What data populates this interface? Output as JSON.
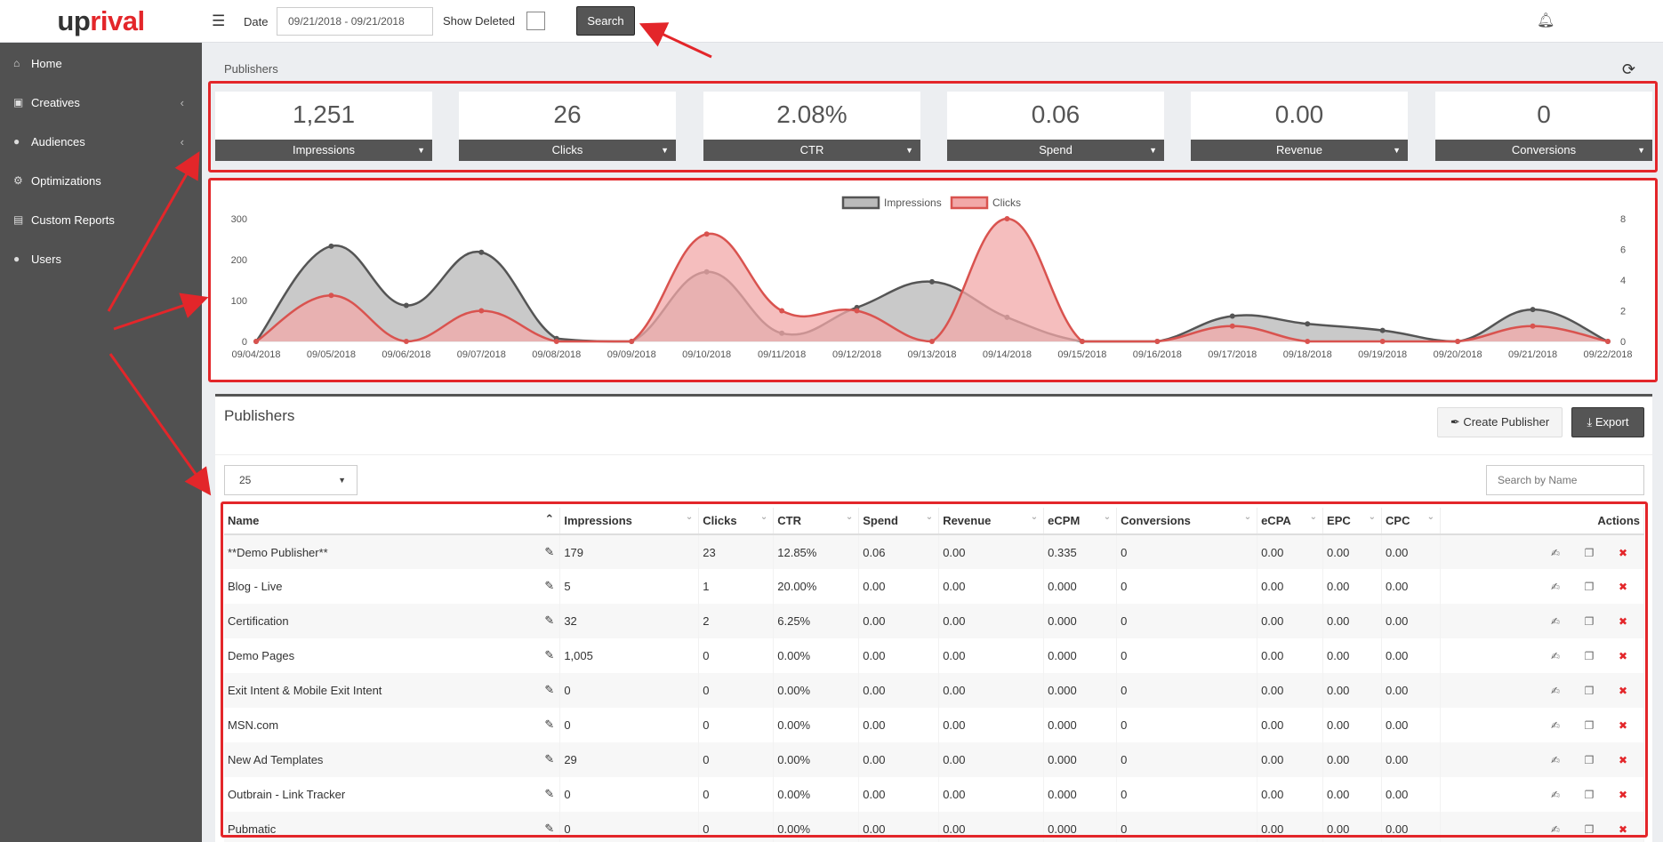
{
  "app": {
    "logo_prefix": "up",
    "logo_suffix": "rival"
  },
  "topbar": {
    "date_label": "Date",
    "date_value": "09/21/2018 - 09/21/2018",
    "show_deleted_label": "Show Deleted",
    "show_deleted_checked": false,
    "search_label": "Search"
  },
  "sidebar": {
    "items": [
      {
        "label": "Home",
        "icon": "home-icon"
      },
      {
        "label": "Creatives",
        "icon": "image-icon",
        "has_submenu": true
      },
      {
        "label": "Audiences",
        "icon": "users-icon",
        "has_submenu": true
      },
      {
        "label": "Optimizations",
        "icon": "cogs-icon"
      },
      {
        "label": "Custom Reports",
        "icon": "file-icon"
      },
      {
        "label": "Users",
        "icon": "user-icon"
      }
    ]
  },
  "content": {
    "section_title": "Publishers"
  },
  "stats": [
    {
      "value": "1,251",
      "label": "Impressions"
    },
    {
      "value": "26",
      "label": "Clicks"
    },
    {
      "value": "2.08%",
      "label": "CTR"
    },
    {
      "value": "0.06",
      "label": "Spend"
    },
    {
      "value": "0.00",
      "label": "Revenue"
    },
    {
      "value": "0",
      "label": "Conversions"
    }
  ],
  "chart_data": {
    "type": "area",
    "x": [
      "09/04/2018",
      "09/05/2018",
      "09/06/2018",
      "09/07/2018",
      "09/08/2018",
      "09/09/2018",
      "09/10/2018",
      "09/11/2018",
      "09/12/2018",
      "09/13/2018",
      "09/14/2018",
      "09/15/2018",
      "09/16/2018",
      "09/17/2018",
      "09/18/2018",
      "09/19/2018",
      "09/20/2018",
      "09/21/2018",
      "09/22/2018"
    ],
    "series": [
      {
        "name": "Impressions",
        "axis": "left",
        "color": "#555555",
        "fill": "#bbbbbb",
        "values": [
          0,
          233,
          88,
          218,
          7,
          0,
          170,
          20,
          83,
          146,
          59,
          0,
          0,
          62,
          43,
          27,
          0,
          78,
          0
        ]
      },
      {
        "name": "Clicks",
        "axis": "right",
        "color": "#d9534f",
        "fill": "#f2a8a8",
        "values": [
          0,
          3,
          0,
          2,
          0,
          0,
          7,
          2,
          2,
          0,
          8,
          0,
          0,
          1,
          0,
          0,
          0,
          1,
          0
        ]
      }
    ],
    "y_left": {
      "ticks": [
        0,
        100,
        200,
        300
      ],
      "range": [
        0,
        300
      ]
    },
    "y_right": {
      "ticks": [
        0,
        2,
        4,
        6,
        8
      ],
      "range": [
        0,
        8
      ]
    },
    "legend_position": "top-center"
  },
  "publishers": {
    "title": "Publishers",
    "create_label": "Create Publisher",
    "export_label": "Export",
    "page_size": "25",
    "search_placeholder": "Search by Name",
    "columns": [
      "Name",
      "Impressions",
      "Clicks",
      "CTR",
      "Spend",
      "Revenue",
      "eCPM",
      "Conversions",
      "eCPA",
      "EPC",
      "CPC",
      "Actions"
    ],
    "rows": [
      [
        "**Demo Publisher**",
        "179",
        "23",
        "12.85%",
        "0.06",
        "0.00",
        "0.335",
        "0",
        "0.00",
        "0.00",
        "0.00"
      ],
      [
        "Blog - Live",
        "5",
        "1",
        "20.00%",
        "0.00",
        "0.00",
        "0.000",
        "0",
        "0.00",
        "0.00",
        "0.00"
      ],
      [
        "Certification",
        "32",
        "2",
        "6.25%",
        "0.00",
        "0.00",
        "0.000",
        "0",
        "0.00",
        "0.00",
        "0.00"
      ],
      [
        "Demo Pages",
        "1,005",
        "0",
        "0.00%",
        "0.00",
        "0.00",
        "0.000",
        "0",
        "0.00",
        "0.00",
        "0.00"
      ],
      [
        "Exit Intent & Mobile Exit Intent",
        "0",
        "0",
        "0.00%",
        "0.00",
        "0.00",
        "0.000",
        "0",
        "0.00",
        "0.00",
        "0.00"
      ],
      [
        "MSN.com",
        "0",
        "0",
        "0.00%",
        "0.00",
        "0.00",
        "0.000",
        "0",
        "0.00",
        "0.00",
        "0.00"
      ],
      [
        "New Ad Templates",
        "29",
        "0",
        "0.00%",
        "0.00",
        "0.00",
        "0.000",
        "0",
        "0.00",
        "0.00",
        "0.00"
      ],
      [
        "Outbrain - Link Tracker",
        "0",
        "0",
        "0.00%",
        "0.00",
        "0.00",
        "0.000",
        "0",
        "0.00",
        "0.00",
        "0.00"
      ],
      [
        "Pubmatic",
        "0",
        "0",
        "0.00%",
        "0.00",
        "0.00",
        "0.000",
        "0",
        "0.00",
        "0.00",
        "0.00"
      ]
    ]
  },
  "annotation_color": "#e3262a"
}
